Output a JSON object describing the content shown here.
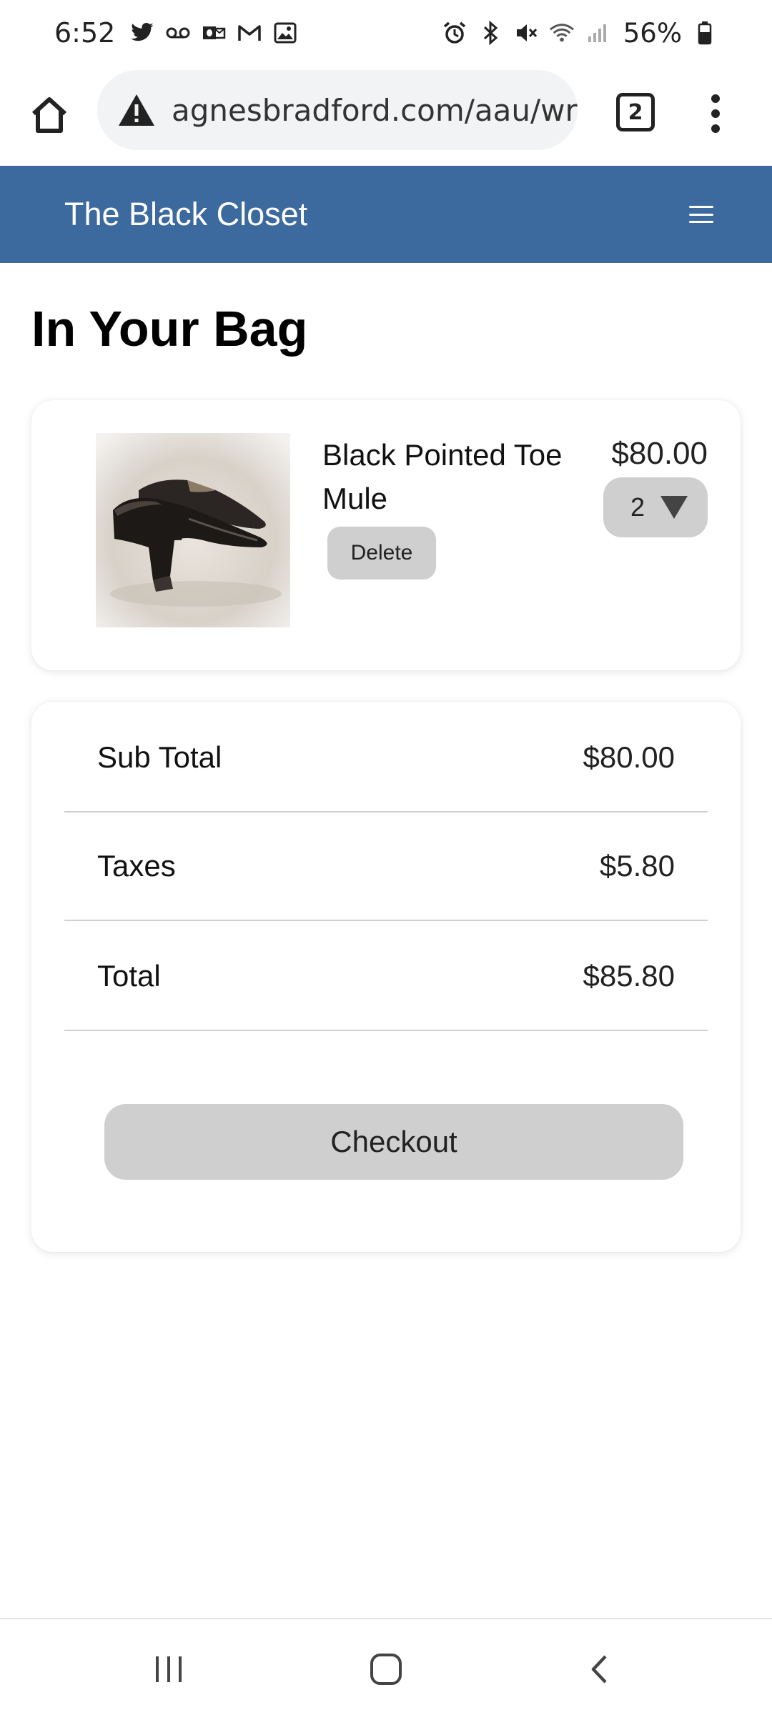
{
  "status_bar": {
    "time": "6:52",
    "battery": "56%",
    "left_icons": [
      "twitter-icon",
      "voicemail-icon",
      "outlook-icon",
      "gmail-icon",
      "gallery-icon"
    ],
    "right_icons": [
      "alarm-icon",
      "bluetooth-icon",
      "mute-icon",
      "wifi-icon",
      "signal-icon",
      "battery-icon"
    ]
  },
  "browser": {
    "url": "agnesbradford.com/aau/wr",
    "tab_count": "2"
  },
  "site": {
    "brand": "The Black Closet",
    "header_color": "#3d6a9e"
  },
  "page": {
    "title": "In Your Bag"
  },
  "cart": {
    "items": [
      {
        "name": "Black Pointed Toe Mule",
        "price": "$80.00",
        "quantity": "2",
        "delete_label": "Delete"
      }
    ]
  },
  "summary": {
    "subtotal_label": "Sub Total",
    "subtotal_value": "$80.00",
    "taxes_label": "Taxes",
    "taxes_value": "$5.80",
    "total_label": "Total",
    "total_value": "$85.80",
    "checkout_label": "Checkout"
  },
  "colors": {
    "button_gray": "#cfcfcf",
    "brand_blue": "#3d6a9e"
  }
}
